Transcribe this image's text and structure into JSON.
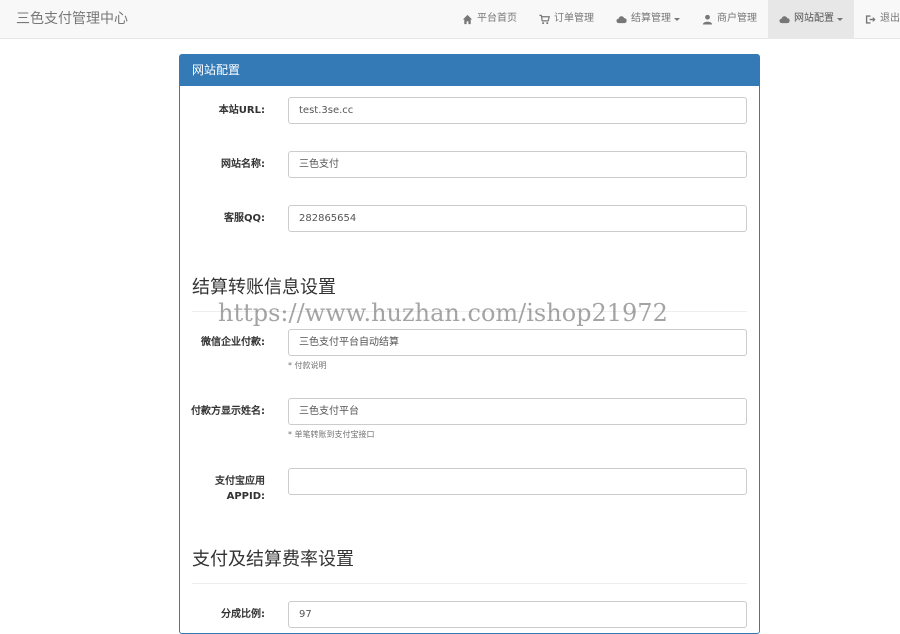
{
  "navbar": {
    "brand": "三色支付管理中心",
    "items": [
      {
        "label": "平台首页",
        "icon": "home-icon"
      },
      {
        "label": "订单管理",
        "icon": "cart-icon"
      },
      {
        "label": "结算管理",
        "icon": "cloud-icon",
        "dropdown": true
      },
      {
        "label": "商户管理",
        "icon": "user-icon"
      },
      {
        "label": "网站配置",
        "icon": "cloud-icon",
        "dropdown": true,
        "active": true
      },
      {
        "label": "退出",
        "icon": "logout-icon"
      }
    ]
  },
  "panel": {
    "title": "网站配置",
    "fields": {
      "site_url": {
        "label": "本站URL:",
        "value": "test.3se.cc"
      },
      "site_name": {
        "label": "网站名称:",
        "value": "三色支付"
      },
      "service_qq": {
        "label": "客服QQ:",
        "value": "282865654"
      },
      "wechat_pay": {
        "label": "微信企业付款:",
        "value": "三色支付平台自动结算",
        "help": "* 付款说明"
      },
      "payer_name": {
        "label": "付款方显示姓名:",
        "value": "三色支付平台",
        "help": "* 单笔转账到支付宝接口"
      },
      "alipay_appid": {
        "label": "支付宝应用APPID:",
        "value": ""
      },
      "split_ratio": {
        "label": "分成比例:",
        "value": "97"
      }
    },
    "sections": {
      "settlement_transfer": "结算转账信息设置",
      "payment_rate": "支付及结算费率设置"
    }
  },
  "watermark": "https://www.huzhan.com/ishop21972"
}
